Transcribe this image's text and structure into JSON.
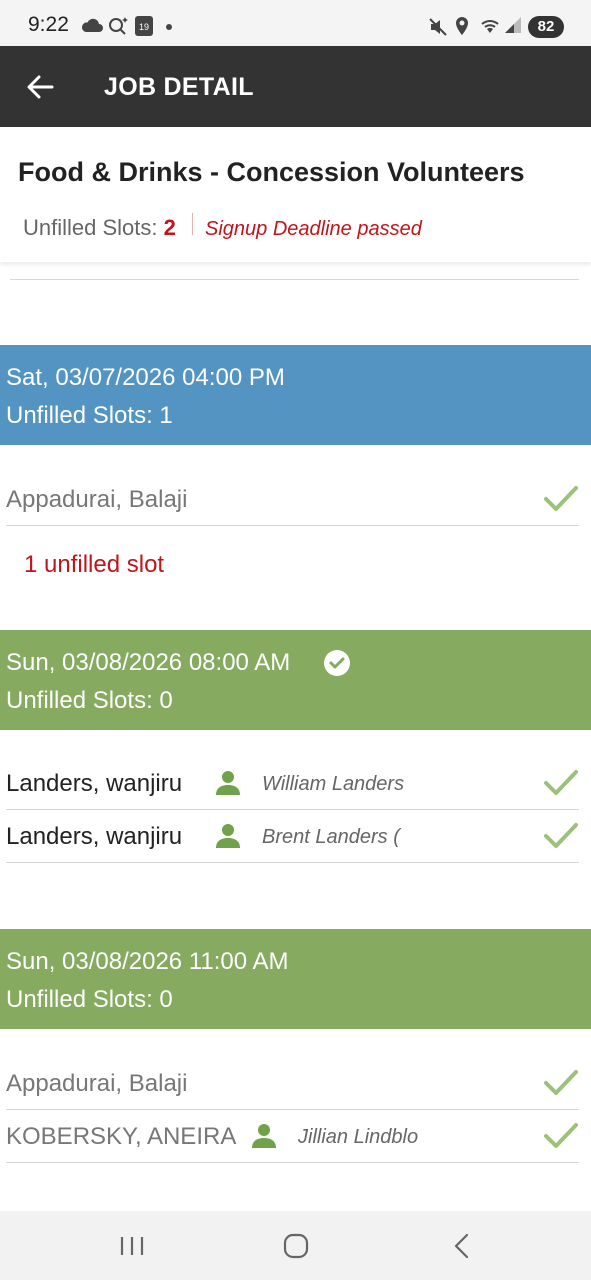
{
  "status_bar": {
    "time": "9:22",
    "battery": "82",
    "icons": [
      "cloud-icon",
      "ai-sparkle-icon",
      "calendar-icon",
      "dot-icon",
      "mute-icon",
      "location-icon",
      "wifi-icon",
      "signal-icon",
      "battery-icon"
    ],
    "calendar_day": "19"
  },
  "app_bar": {
    "title": "JOB DETAIL",
    "back_icon": "arrow-left-icon"
  },
  "job": {
    "title": "Food & Drinks - Concession Volunteers",
    "unfilled_label": "Unfilled Slots: ",
    "unfilled_count": "2",
    "deadline": "Signup Deadline passed"
  },
  "shifts": [
    {
      "date": "Sat, 03/07/2026 04:00 PM",
      "unfilled": "Unfilled Slots: 1",
      "status_color": "#5494c3",
      "rows": [
        {
          "name": "Appadurai, Balaji",
          "guest": ""
        }
      ],
      "unfilled_note": "1 unfilled slot"
    },
    {
      "date": "Sun, 03/08/2026 08:00 AM",
      "unfilled": "Unfilled Slots: 0",
      "status_color": "#86aa60",
      "filled_badge": "check-circle-icon",
      "rows": [
        {
          "name": "Landers, wanjiru",
          "guest": "William Landers"
        },
        {
          "name": "Landers, wanjiru",
          "guest": "Brent Landers ("
        }
      ]
    },
    {
      "date": "Sun, 03/08/2026 11:00 AM",
      "unfilled": "Unfilled Slots: 0",
      "status_color": "#86aa60",
      "rows": [
        {
          "name": "Appadurai, Balaji",
          "guest": ""
        },
        {
          "name": "KOBERSKY, ANEIRA",
          "guest": "Jillian Lindblo"
        }
      ]
    }
  ],
  "colors": {
    "app_bar": "#333333",
    "accent_red": "#c0151b",
    "check_green": "#9cc27a",
    "person_green": "#6fa24a"
  },
  "nav_bar": {
    "buttons": [
      "recent-apps-icon",
      "home-icon",
      "back-icon"
    ]
  }
}
